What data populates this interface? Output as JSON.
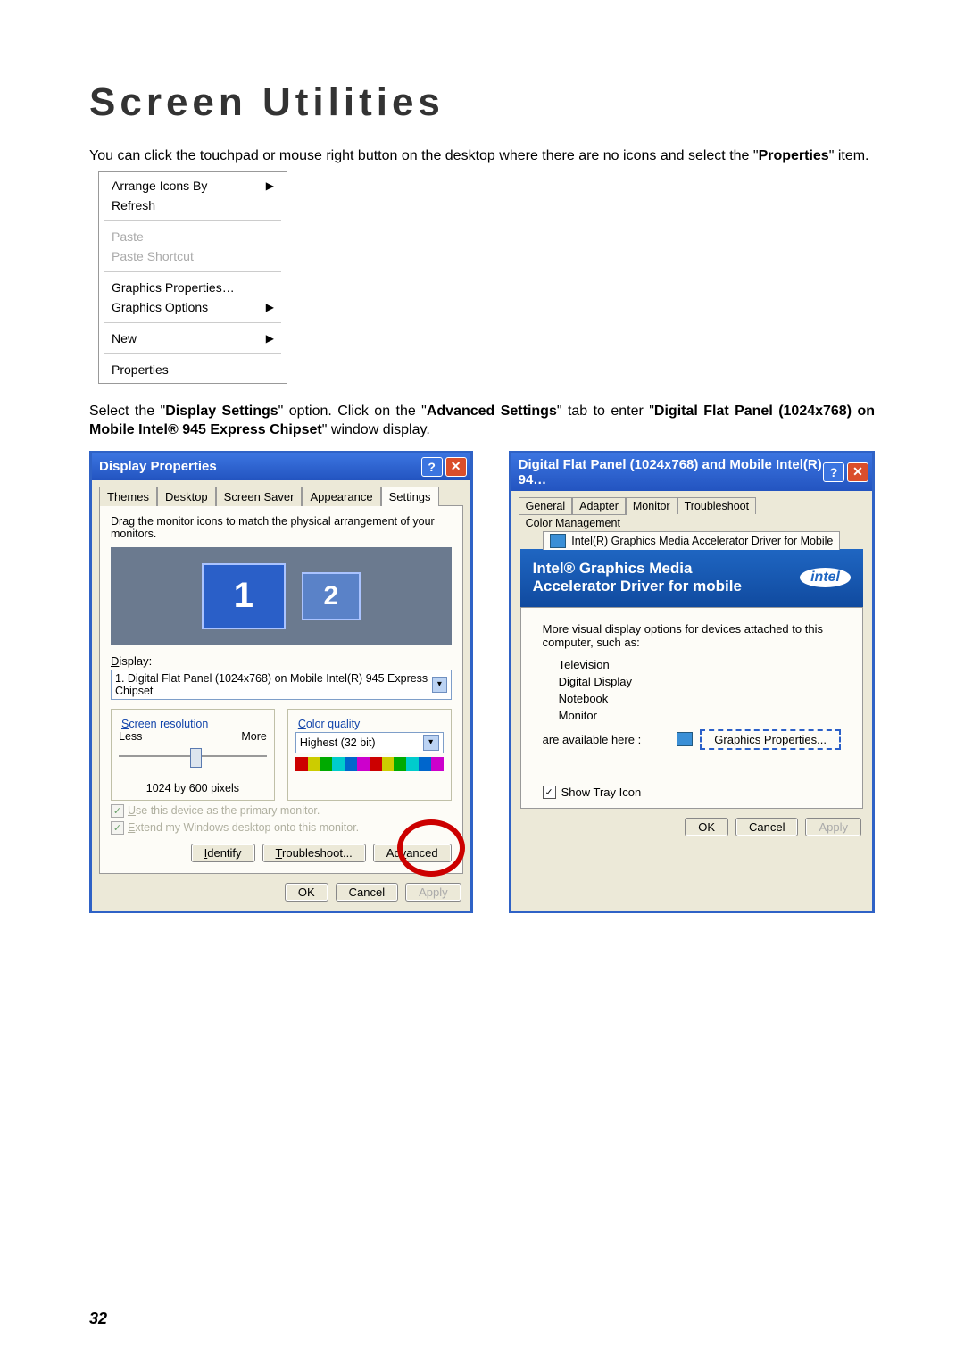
{
  "heading": "Screen Utilities",
  "para1_a": "You can click the touchpad or mouse right button on the desktop where there are no icons and select the \"",
  "para1_bold": "Properties",
  "para1_b": "\" item.",
  "ctx": {
    "arrange": "Arrange Icons By",
    "refresh": "Refresh",
    "paste": "Paste",
    "paste_shortcut": "Paste Shortcut",
    "gp_props": "Graphics Properties…",
    "gp_opts": "Graphics Options",
    "new": "New",
    "props": "Properties"
  },
  "para2": {
    "a": "Select the \"",
    "b1": "Display Settings",
    "c": "\" option. Click on the \"",
    "b2": "Advanced Settings",
    "d": "\" tab to enter \"",
    "b3": "Digital Flat Panel (1024x768) on Mobile Intel® 945 Express Chipset",
    "e": "\" window display."
  },
  "win1": {
    "title": "Display Properties",
    "tabs": [
      "Themes",
      "Desktop",
      "Screen Saver",
      "Appearance",
      "Settings"
    ],
    "drag_hint": "Drag the monitor icons to match the physical arrangement of your monitors.",
    "mon1": "1",
    "mon2": "2",
    "display_lbl": "Display:",
    "display_val": "1. Digital Flat Panel (1024x768) on Mobile Intel(R) 945 Express Chipset",
    "res_legend": "Screen resolution",
    "less": "Less",
    "more": "More",
    "res_caption": "1024 by 600 pixels",
    "cq_legend": "Color quality",
    "cq_val": "Highest (32 bit)",
    "chk1": "Use this device as the primary monitor.",
    "chk2": "Extend my Windows desktop onto this monitor.",
    "identify": "Identify",
    "troubleshoot": "Troubleshoot...",
    "advanced": "Advanced",
    "ok": "OK",
    "cancel": "Cancel",
    "apply": "Apply"
  },
  "win2": {
    "title": "Digital Flat Panel (1024x768) and Mobile Intel(R) 94…",
    "tabs_top": [
      "General",
      "Adapter",
      "Monitor",
      "Troubleshoot",
      "Color Management"
    ],
    "tabs_bottom": "Intel(R) Graphics Media Accelerator Driver for Mobile",
    "band1": "Intel® Graphics Media",
    "band2": "Accelerator Driver for mobile",
    "intel": "intel",
    "more_opts": "More visual display options for devices attached to this computer, such as:",
    "opts": [
      "Television",
      "Digital Display",
      "Notebook",
      "Monitor"
    ],
    "avail": "are available here :",
    "gp_btn": "Graphics Properties...",
    "tray": "Show Tray Icon",
    "ok": "OK",
    "cancel": "Cancel",
    "apply": "Apply"
  },
  "pagenum": "32"
}
